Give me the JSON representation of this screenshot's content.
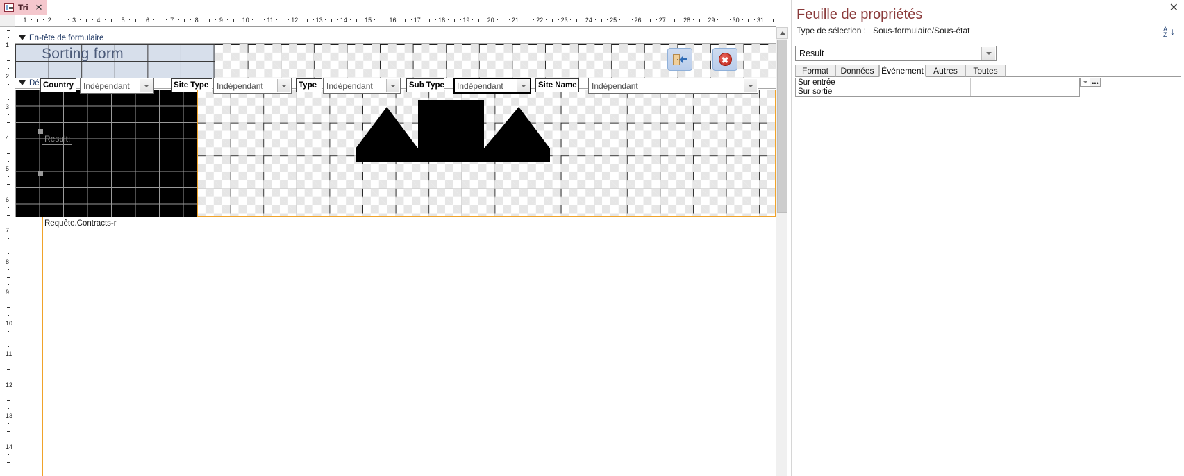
{
  "tab": {
    "label": "Tri",
    "icon": "form-design-icon",
    "close_label": "✕"
  },
  "designer": {
    "hruler_numbers": [
      1,
      2,
      3,
      4,
      5,
      6,
      7,
      8,
      9,
      10,
      11,
      12,
      13,
      14,
      15,
      16,
      17,
      18,
      19,
      20,
      21,
      22,
      23,
      24,
      25,
      26,
      27,
      28,
      29,
      30,
      31
    ],
    "vruler_numbers": [
      1,
      2,
      3,
      4,
      5,
      6,
      7,
      8,
      9,
      10,
      11,
      12,
      13,
      14
    ],
    "sections": [
      {
        "label": "En-tête de formulaire"
      },
      {
        "label": "Détail"
      }
    ],
    "form_title": "Sorting form",
    "header_buttons": [
      {
        "name": "exit-door-button",
        "icon": "door-exit-icon"
      },
      {
        "name": "close-red-button",
        "icon": "red-x-circle-icon"
      }
    ],
    "filters": [
      {
        "label": "Country",
        "value": "Indépendant",
        "selected": false
      },
      {
        "label": "Site Type",
        "value": "Indépendant",
        "selected": false
      },
      {
        "label": "Type",
        "value": "Indépendant",
        "selected": false
      },
      {
        "label": "Sub Type",
        "value": "Indépendant",
        "selected": true
      },
      {
        "label": "Site Name",
        "value": "Indépendant",
        "selected": false
      }
    ],
    "result_label": "Result:",
    "subform_caption": "Requête.Contracts-r"
  },
  "property_sheet": {
    "title": "Feuille de propriétés",
    "selection_type_label": "Type de sélection :",
    "selection_type_value": "Sous-formulaire/Sous-état",
    "sort_icon": "sort-az-icon",
    "close_label": "✕",
    "selected_object": "Result",
    "tabs": [
      {
        "label": "Format",
        "active": false
      },
      {
        "label": "Données",
        "active": false
      },
      {
        "label": "Événement",
        "active": true
      },
      {
        "label": "Autres",
        "active": false
      },
      {
        "label": "Toutes",
        "active": false
      }
    ],
    "rows": [
      {
        "name": "Sur entrée",
        "value": ""
      },
      {
        "name": "Sur sortie",
        "value": ""
      }
    ],
    "row_dropdown_icon": "chevron-down-icon",
    "row_builder_icon": "ellipsis-icon"
  },
  "colors": {
    "tab_active": "#f4c7cd",
    "header_band": "#d7dfeb",
    "title_text": "#4b5a78",
    "prop_title": "#8a3a3a",
    "section_text": "#1f3864",
    "selection_orange": "#f0a32a"
  }
}
